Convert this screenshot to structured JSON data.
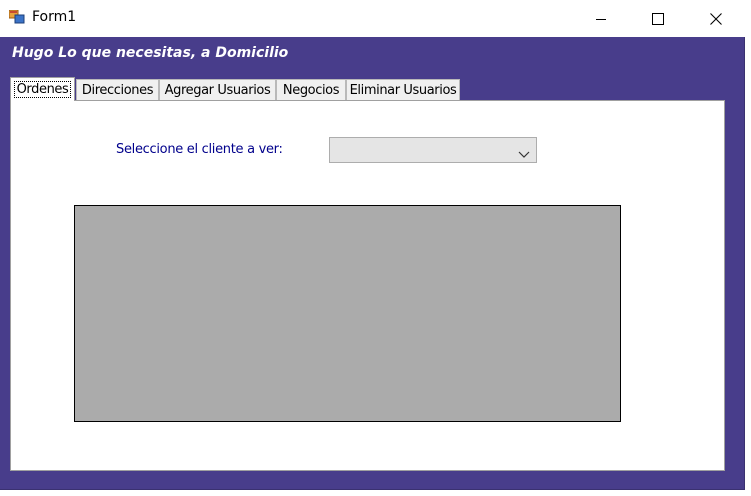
{
  "window": {
    "title": "Form1",
    "icons": {
      "app": "form-app-icon",
      "minimize": "minimize-icon",
      "maximize": "maximize-icon",
      "close": "close-icon"
    }
  },
  "header": {
    "label": "Hugo Lo que necesitas, a Domicilio"
  },
  "tabs": [
    {
      "label": "Ordenes",
      "active": true
    },
    {
      "label": "Direcciones",
      "active": false
    },
    {
      "label": "Agregar Usuarios",
      "active": false
    },
    {
      "label": "Negocios",
      "active": false
    },
    {
      "label": "Eliminar Usuarios",
      "active": false
    }
  ],
  "ordenes": {
    "client_label": "Seleccione el cliente a ver:",
    "client_select_value": "",
    "dropdown_icon": "chevron-down-icon"
  },
  "colors": {
    "window_background": "#483D8B",
    "label_text": "#00008B",
    "grid_background": "#ABABAB"
  }
}
